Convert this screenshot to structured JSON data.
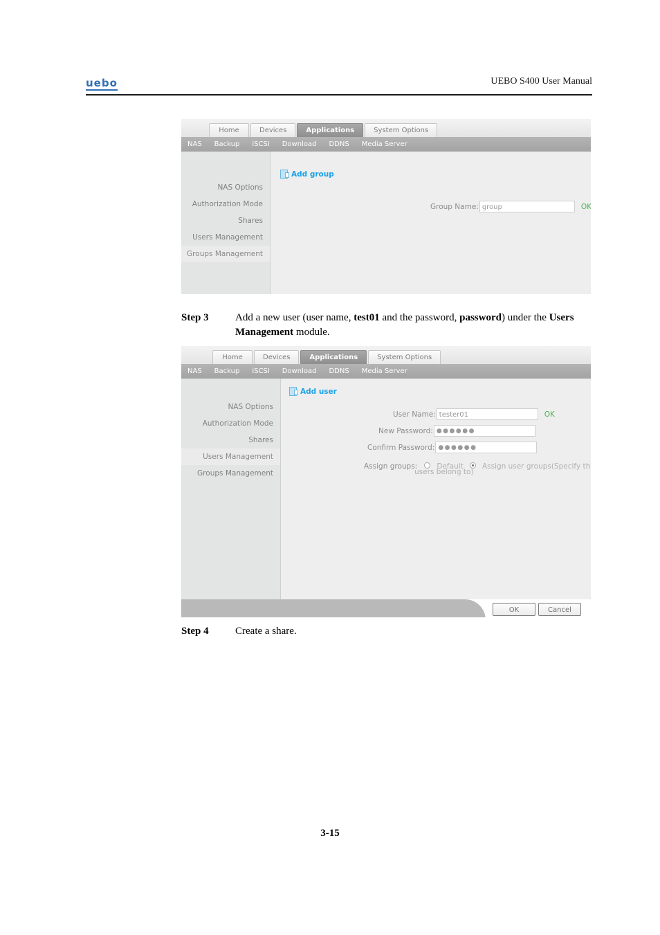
{
  "document": {
    "logo_text": "uebo",
    "header_title": "UEBO S400 User Manual",
    "page_number": "3-15"
  },
  "steps": [
    {
      "label": "Step 3",
      "text_parts": [
        {
          "t": "Add a new user (user name, ",
          "bold": false
        },
        {
          "t": "test01",
          "bold": true
        },
        {
          "t": " and the password, ",
          "bold": false
        },
        {
          "t": "password",
          "bold": true
        },
        {
          "t": ") under the ",
          "bold": false
        },
        {
          "t": "Users Management",
          "bold": true
        },
        {
          "t": " module.",
          "bold": false
        }
      ]
    },
    {
      "label": "Step 4",
      "text_parts": [
        {
          "t": "Create a share.",
          "bold": false
        }
      ]
    }
  ],
  "screenshot_groups": {
    "tabs": [
      {
        "label": "Home",
        "active": false
      },
      {
        "label": "Devices",
        "active": false
      },
      {
        "label": "Applications",
        "active": true
      },
      {
        "label": "System Options",
        "active": false
      }
    ],
    "subnav": [
      {
        "label": "NAS",
        "active": true
      },
      {
        "label": "Backup",
        "active": false
      },
      {
        "label": "iSCSI",
        "active": false
      },
      {
        "label": "Download",
        "active": false
      },
      {
        "label": "DDNS",
        "active": false
      },
      {
        "label": "Media Server",
        "active": false
      }
    ],
    "sidebar": [
      {
        "label": "NAS Options",
        "active": false
      },
      {
        "label": "Authorization Mode",
        "active": false
      },
      {
        "label": "Shares",
        "active": false
      },
      {
        "label": "Users Management",
        "active": false
      },
      {
        "label": "Groups Management",
        "active": true
      }
    ],
    "add_link": "Add group",
    "add_icon": "new-document-icon",
    "form": {
      "group_name_label": "Group Name:",
      "group_name_value": "group",
      "ok_label": "OK"
    }
  },
  "screenshot_users": {
    "tabs": [
      {
        "label": "Home",
        "active": false
      },
      {
        "label": "Devices",
        "active": false
      },
      {
        "label": "Applications",
        "active": true
      },
      {
        "label": "System Options",
        "active": false
      }
    ],
    "subnav": [
      {
        "label": "NAS",
        "active": true
      },
      {
        "label": "Backup",
        "active": false
      },
      {
        "label": "iSCSI",
        "active": false
      },
      {
        "label": "Download",
        "active": false
      },
      {
        "label": "DDNS",
        "active": false
      },
      {
        "label": "Media Server",
        "active": false
      }
    ],
    "sidebar": [
      {
        "label": "NAS Options",
        "active": false
      },
      {
        "label": "Authorization Mode",
        "active": false
      },
      {
        "label": "Shares",
        "active": false
      },
      {
        "label": "Users Management",
        "active": true
      },
      {
        "label": "Groups Management",
        "active": false
      }
    ],
    "add_link": "Add user",
    "add_icon": "new-document-icon",
    "form": {
      "user_name_label": "User Name:",
      "user_name_value": "tester01",
      "ok_label": "OK",
      "new_password_label": "New Password:",
      "new_password_value": "●●●●●●",
      "confirm_password_label": "Confirm Password:",
      "confirm_password_value": "●●●●●●",
      "assign_groups_label": "Assign groups:",
      "radio_default_label": "Default",
      "radio_assign_label": "Assign user groups(Specify the user groups",
      "radio_assign_label_line2": "users belong to)",
      "radio_selected": "assign"
    },
    "footer": {
      "ok_label": "OK",
      "cancel_label": "Cancel"
    }
  },
  "colors": {
    "link_blue": "#1aa3e8",
    "ok_green": "#4bb34b",
    "logo_blue": "#2f6fb5",
    "active_tab_gray": "#9d9d9d",
    "subnav_arrow_orange": "#f0a020"
  }
}
